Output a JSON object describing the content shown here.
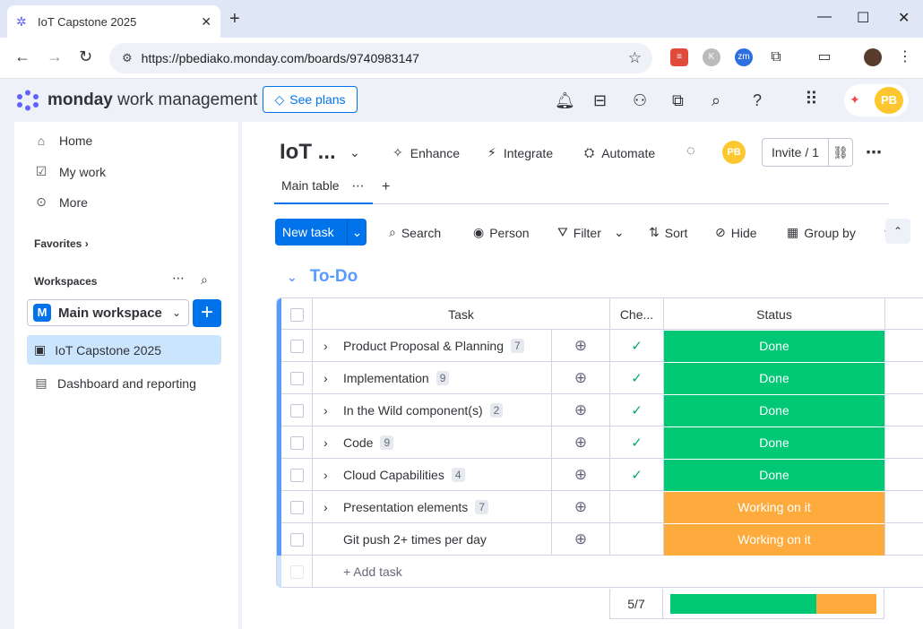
{
  "browser": {
    "tab_title": "IoT Capstone 2025",
    "url": "https://pbediako.monday.com/boards/9740983147"
  },
  "header": {
    "brand_bold": "monday",
    "brand_rest": " work management",
    "see_plans": "See plans",
    "avatar_initials": "PB"
  },
  "sidebar": {
    "home": "Home",
    "my_work": "My work",
    "more": "More",
    "favorites": "Favorites",
    "workspaces": "Workspaces",
    "workspace_name": "Main workspace",
    "workspace_initial": "M",
    "boards": [
      {
        "label": "IoT Capstone 2025"
      },
      {
        "label": "Dashboard and reporting"
      }
    ]
  },
  "board": {
    "title": "IoT ...",
    "enhance": "Enhance",
    "integrate": "Integrate",
    "automate": "Automate",
    "invite": "Invite / 1",
    "avatar_initials": "PB",
    "view_tab": "Main table"
  },
  "toolbar": {
    "new_task": "New task",
    "search": "Search",
    "person": "Person",
    "filter": "Filter",
    "sort": "Sort",
    "hide": "Hide",
    "group_by": "Group by"
  },
  "group": {
    "title": "To-Do",
    "columns": {
      "task": "Task",
      "check": "Che...",
      "status": "Status"
    },
    "rows": [
      {
        "task": "Product Proposal & Planning",
        "count": "7",
        "checked": true,
        "status": "Done",
        "color": "#00c875"
      },
      {
        "task": "Implementation",
        "count": "9",
        "checked": true,
        "status": "Done",
        "color": "#00c875"
      },
      {
        "task": "In the Wild component(s)",
        "count": "2",
        "checked": true,
        "status": "Done",
        "color": "#00c875"
      },
      {
        "task": "Code",
        "count": "9",
        "checked": true,
        "status": "Done",
        "color": "#00c875"
      },
      {
        "task": "Cloud Capabilities",
        "count": "4",
        "checked": true,
        "status": "Done",
        "color": "#00c875"
      },
      {
        "task": "Presentation elements",
        "count": "7",
        "checked": false,
        "status": "Working on it",
        "color": "#fdab3d"
      },
      {
        "task": "Git push 2+ times per day",
        "count": "",
        "checked": false,
        "status": "Working on it",
        "color": "#fdab3d"
      }
    ],
    "add_task": "+ Add task",
    "summary_check": "5/7",
    "summary_done_fraction": 0.71
  },
  "colors": {
    "accent": "#0073ea",
    "done": "#00c875",
    "working": "#fdab3d",
    "group": "#579bfc"
  }
}
